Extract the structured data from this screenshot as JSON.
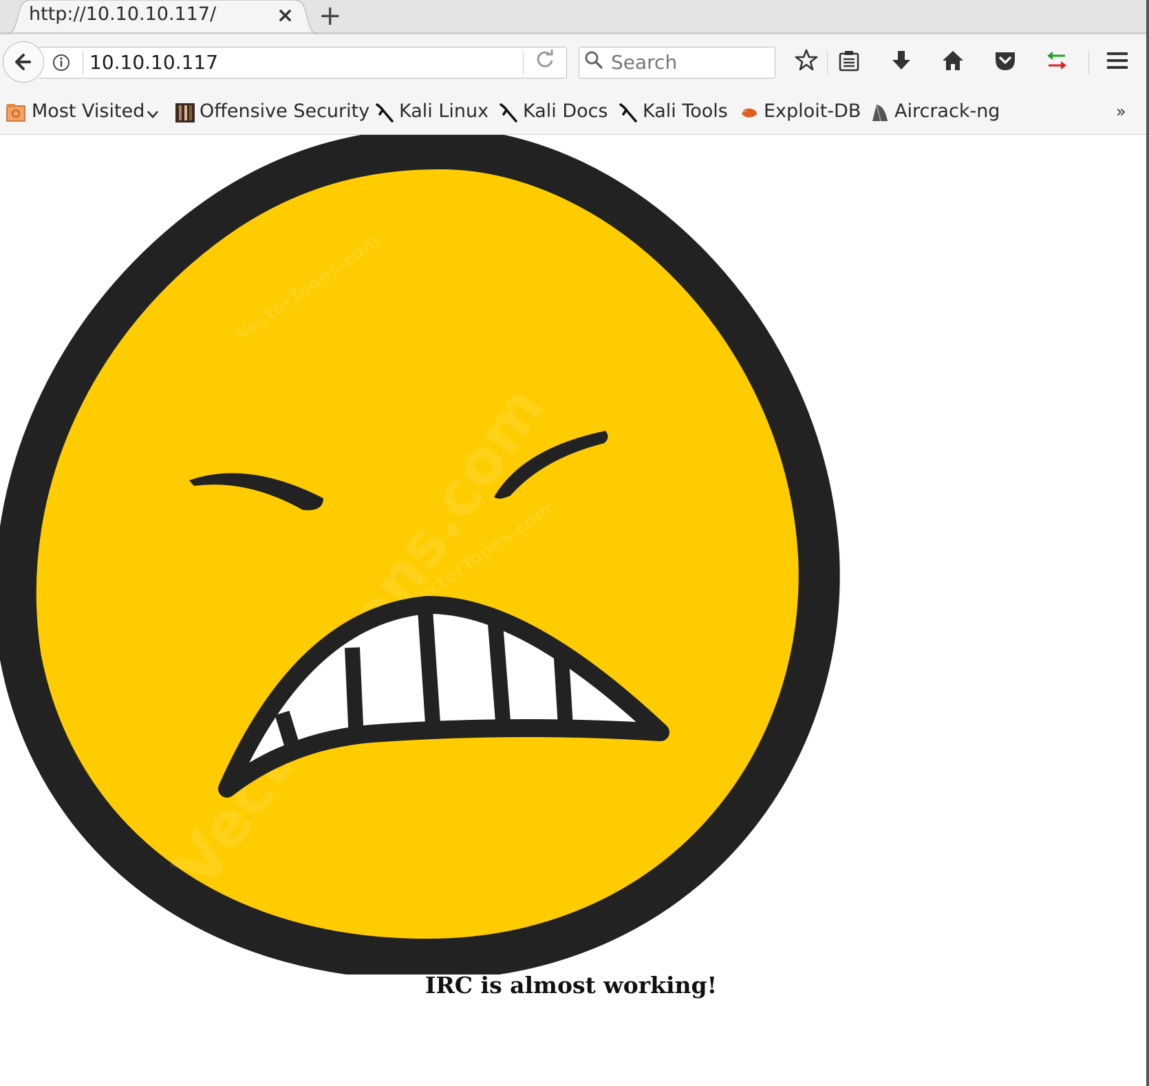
{
  "tab": {
    "title": "http://10.10.10.117/",
    "close": "×",
    "new_tab": "+"
  },
  "navbar": {
    "url": "10.10.10.117",
    "search_placeholder": "Search"
  },
  "bookmarks": {
    "most_visited": "Most Visited",
    "items": [
      "Offensive Security",
      "Kali Linux",
      "Kali Docs",
      "Kali Tools",
      "Exploit-DB",
      "Aircrack-ng"
    ],
    "overflow": "»"
  },
  "page": {
    "caption": "IRC is almost working!",
    "image": {
      "icon": "angry-smiley",
      "face_color": "#ffcc00",
      "outline_color": "#222222",
      "watermark": "VectorToons.com"
    }
  },
  "colors": {
    "accent_green": "#2a9d2a",
    "accent_red": "#e02020",
    "bookmark_orange": "#e06020"
  }
}
